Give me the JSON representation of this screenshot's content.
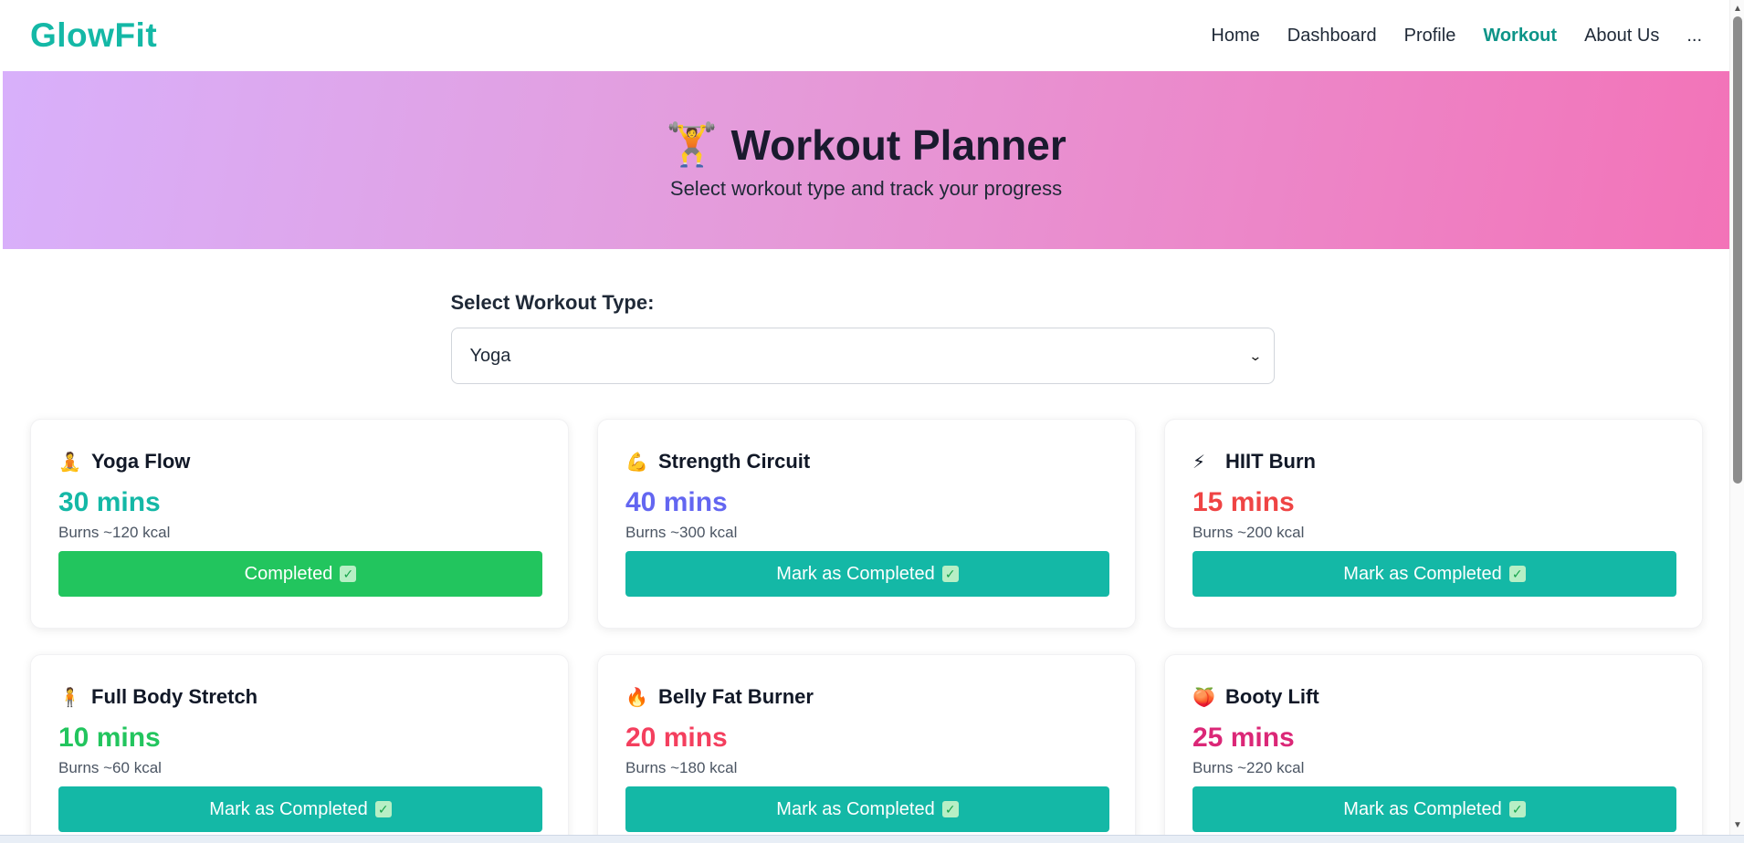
{
  "brand": "GlowFit",
  "nav": {
    "items": [
      "Home",
      "Dashboard",
      "Profile",
      "Workout",
      "About Us",
      "..."
    ],
    "active": "Workout"
  },
  "hero": {
    "emoji": "🏋️",
    "title": "Workout Planner",
    "subtitle": "Select workout type and track your progress"
  },
  "selector": {
    "label": "Select Workout Type:",
    "value": "Yoga"
  },
  "cards": [
    {
      "emoji": "🧘",
      "title": "Yoga Flow",
      "mins": "30 mins",
      "kcal": "Burns ~120 kcal",
      "button": "Completed",
      "done": true,
      "color": "#14b8a6"
    },
    {
      "emoji": "💪",
      "title": "Strength Circuit",
      "mins": "40 mins",
      "kcal": "Burns ~300 kcal",
      "button": "Mark as Completed",
      "done": false,
      "color": "#6366f1"
    },
    {
      "emoji": "⚡",
      "title": "HIIT Burn",
      "mins": "15 mins",
      "kcal": "Burns ~200 kcal",
      "button": "Mark as Completed",
      "done": false,
      "color": "#ef4444"
    },
    {
      "emoji": "🧍",
      "title": "Full Body Stretch",
      "mins": "10 mins",
      "kcal": "Burns ~60 kcal",
      "button": "Mark as Completed",
      "done": false,
      "color": "#22c55e"
    },
    {
      "emoji": "🔥",
      "title": "Belly Fat Burner",
      "mins": "20 mins",
      "kcal": "Burns ~180 kcal",
      "button": "Mark as Completed",
      "done": false,
      "color": "#f43f5e"
    },
    {
      "emoji": "🍑",
      "title": "Booty Lift",
      "mins": "25 mins",
      "kcal": "Burns ~220 kcal",
      "button": "Mark as Completed",
      "done": false,
      "color": "#db2777"
    }
  ],
  "check_glyph": "✓",
  "colors": {
    "brand": "#14b8a6",
    "nav_active": "#0d9488",
    "button": "#14b8a6",
    "button_done": "#22c55e",
    "hero_gradient": [
      "#d8b0fb",
      "#f373b8"
    ]
  }
}
